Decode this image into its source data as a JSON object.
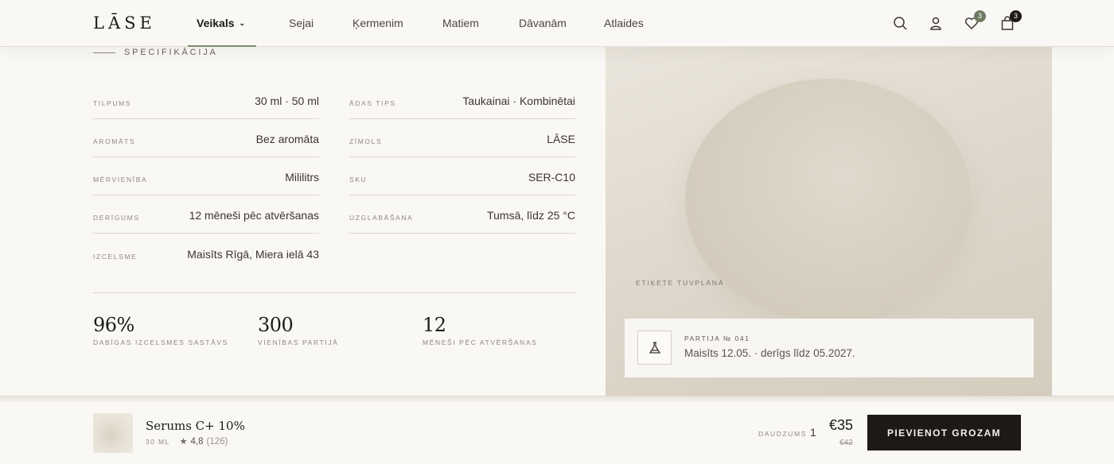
{
  "header": {
    "logo": "LĀSE",
    "nav": [
      {
        "label": "Veikals",
        "active": true
      },
      {
        "label": "Sejai"
      },
      {
        "label": "Ķermenim"
      },
      {
        "label": "Matiem"
      },
      {
        "label": "Dāvanām"
      },
      {
        "label": "Atlaides"
      }
    ],
    "icons": [
      "search-icon",
      "user-icon",
      "heart-icon",
      "bag-icon"
    ],
    "wishlist_count": "3",
    "cart_count": "3",
    "wishlist_badge_color": "#6d7a5f",
    "cart_badge_color": "#1d1916"
  },
  "spec": {
    "section_label": "SPECIFIKĀCIJA",
    "left": [
      {
        "key": "TILPUMS",
        "value": "30 ml · 50 ml"
      },
      {
        "key": "AROMĀTS",
        "value": "Bez aromāta"
      },
      {
        "key": "MĒRVIENĪBA",
        "value": "Mililitrs"
      },
      {
        "key": "DERĪGUMS",
        "value": "12 mēneši pēc atvēršanas"
      },
      {
        "key": "IZCELSME",
        "value": "Maisīts Rīgā, Miera ielā 43"
      }
    ],
    "right": [
      {
        "key": "ĀDAS TIPS",
        "value": "Taukainai · Kombinētai"
      },
      {
        "key": "ZĪMOLS",
        "value": "LĀSE"
      },
      {
        "key": "SKU",
        "value": "SER-C10"
      },
      {
        "key": "UZGLABĀŠANA",
        "value": "Tumsā, līdz 25 °C"
      }
    ],
    "stats": [
      {
        "value": "96%",
        "label": "DABĪGAS IZCELSMES SASTĀVS"
      },
      {
        "value": "300",
        "label": "VIENĪBAS PARTIJĀ"
      },
      {
        "value": "12",
        "label": "MĒNEŠI PĒC ATVĒRŠANAS"
      }
    ]
  },
  "panel": {
    "caption": "ETIĶETE TUVPLĀNĀ",
    "batch_title": "PARTIJA № 041",
    "batch_text": "Maisīts 12.05. · derīgs līdz 05.2027.",
    "batch_icon": "flask-icon"
  },
  "sticky": {
    "product_name": "Serums C+ 10%",
    "size": "30 ML",
    "rating": "4,8",
    "review_count": "(126)",
    "qty_label": "DAUDZUMS",
    "qty_value": "1",
    "price": "€35",
    "old_price": "€42",
    "cta": "PIEVIENOT GROZAM"
  }
}
